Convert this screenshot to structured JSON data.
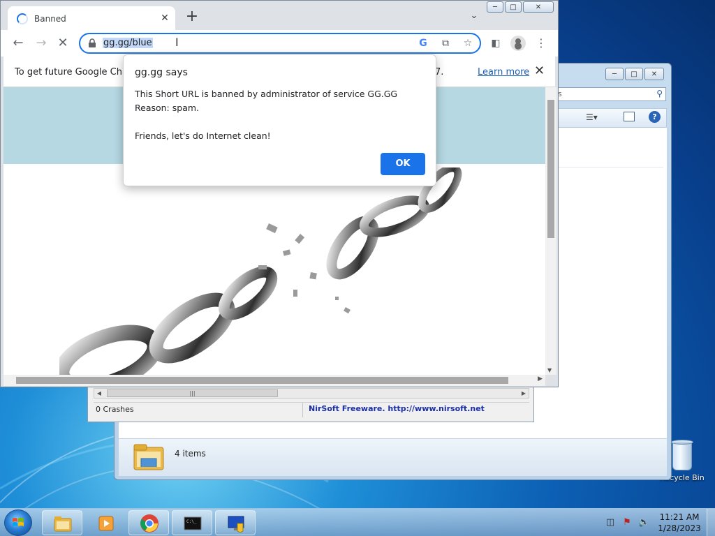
{
  "browser": {
    "tab_title": "Banned",
    "url": "gg.gg/blue",
    "infobar_message_start": "To get future Google Chron",
    "infobar_message_end": "7.",
    "infobar_link": "Learn more"
  },
  "dialog": {
    "title": "gg.gg says",
    "message": "This Short URL is banned by administrator of service GG.GG\nReason: spam.\n\nFriends, let's do Internet clean!",
    "ok_label": "OK"
  },
  "nirsoft": {
    "status_left": "0 Crashes",
    "status_right": "NirSoft Freeware.  http://www.nirsoft.net"
  },
  "explorer": {
    "search_placeholder": "s",
    "items_count": "4 items"
  },
  "desktop": {
    "recycle_bin_label": "Recycle Bin"
  },
  "taskbar": {
    "time": "11:21 AM",
    "date": "1/28/2023"
  },
  "icons": {
    "start": "windows-logo-icon",
    "explorer": "folder-icon",
    "media": "media-player-icon",
    "chrome": "chrome-icon",
    "cmd": "command-prompt-icon",
    "rdp": "remote-desktop-icon"
  }
}
